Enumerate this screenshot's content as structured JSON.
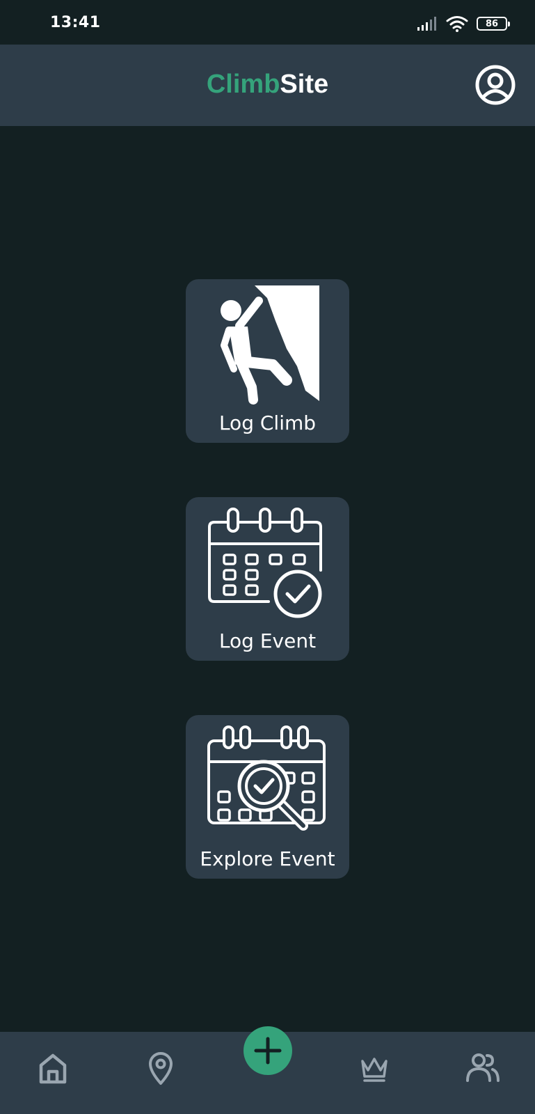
{
  "status_bar": {
    "time": "13:41",
    "battery": "86",
    "icons": [
      "signal-icon",
      "wifi-icon",
      "battery-icon"
    ]
  },
  "header": {
    "title_accent": "Climb",
    "title_rest": "Site",
    "profile_icon": "user-circle-icon"
  },
  "actions": [
    {
      "label": "Log Climb",
      "icon": "climber-icon"
    },
    {
      "label": "Log Event",
      "icon": "calendar-check-icon"
    },
    {
      "label": "Explore Event",
      "icon": "calendar-search-icon"
    }
  ],
  "bottom_nav": {
    "items": [
      "home-icon",
      "location-pin-icon",
      "add-icon",
      "crown-icon",
      "users-icon"
    ]
  },
  "colors": {
    "background": "#132022",
    "surface": "#2e3d49",
    "accent": "#35a37b",
    "nav_icon": "#9aa6b0",
    "text": "#ffffff"
  }
}
